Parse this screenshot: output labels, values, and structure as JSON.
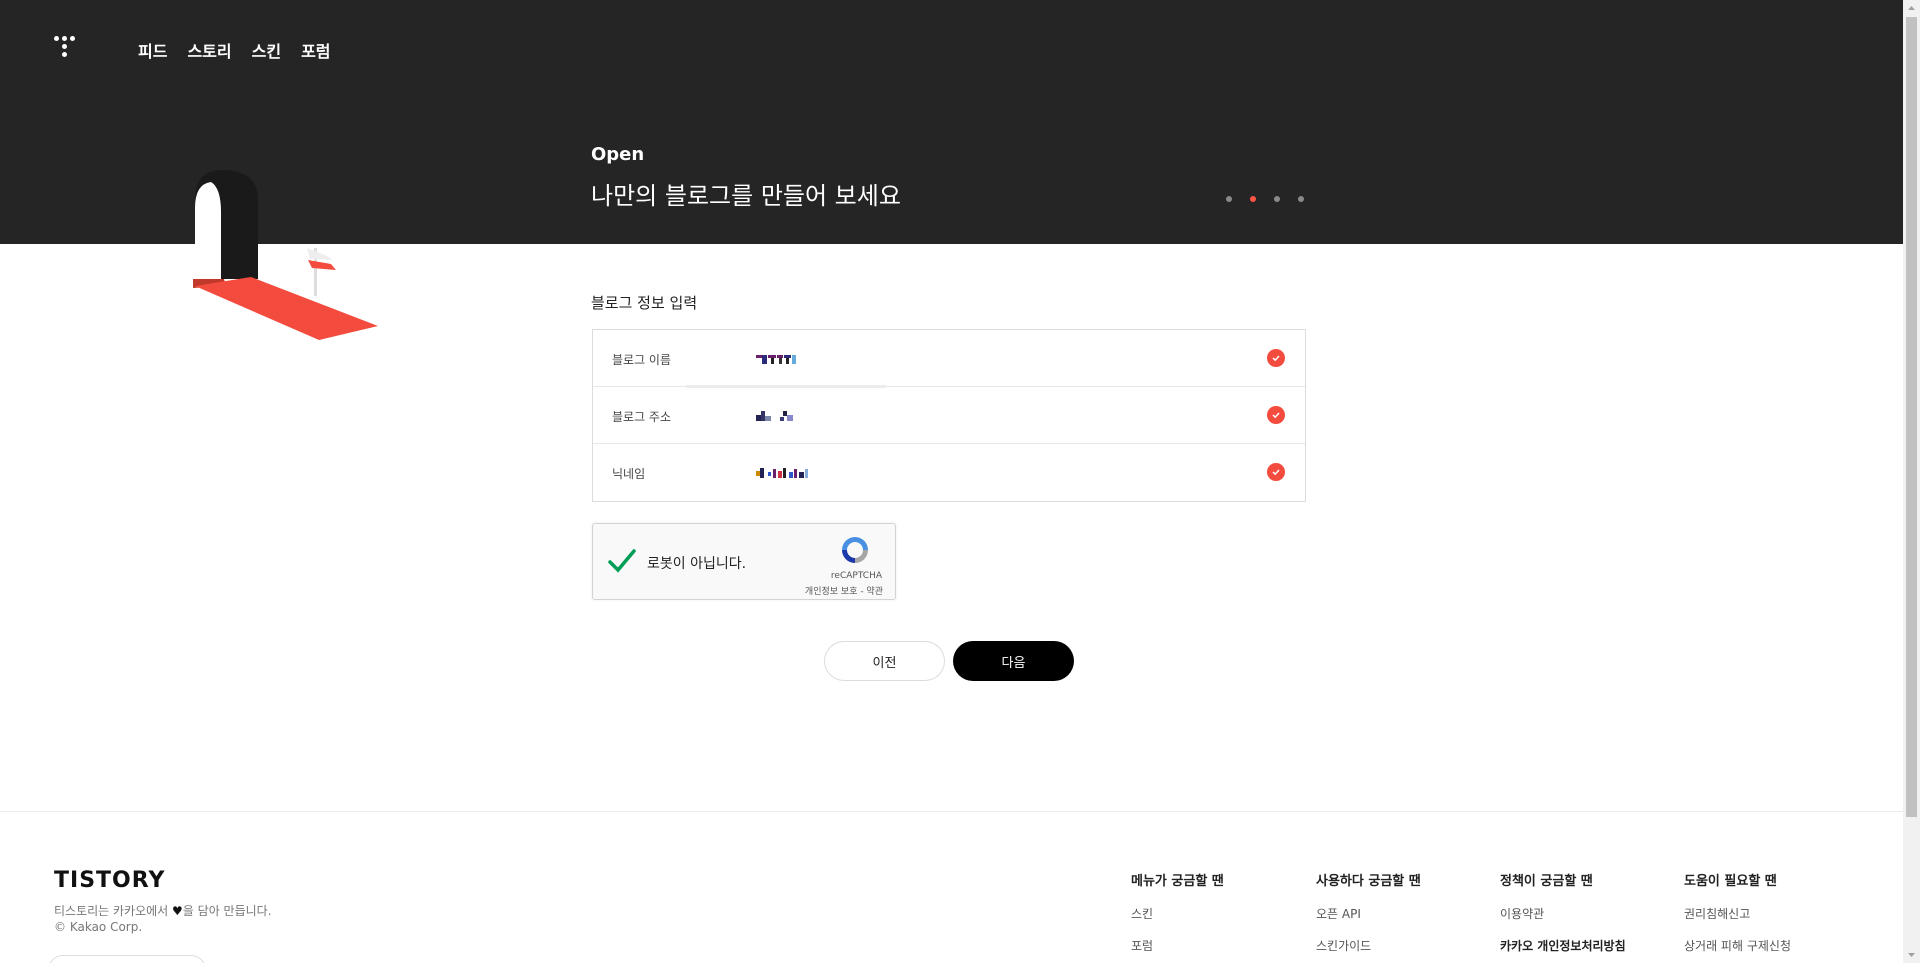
{
  "header": {
    "nav": [
      "피드",
      "스토리",
      "스킨",
      "포럼"
    ],
    "kicker": "Open",
    "title": "나만의 블로그를 만들어 보세요",
    "carousel_total": 4,
    "carousel_active": 2
  },
  "form": {
    "section_title": "블로그 정보 입력",
    "rows": [
      {
        "label": "블로그 이름",
        "value": "(redacted)",
        "valid": true
      },
      {
        "label": "블로그 주소",
        "value": "(redacted)",
        "valid": true
      },
      {
        "label": "닉네임",
        "value": "(redacted)",
        "valid": true
      }
    ]
  },
  "captcha": {
    "label": "로봇이 아닙니다.",
    "brand": "reCAPTCHA",
    "links": "개인정보 보호 - 약관",
    "checked": true
  },
  "buttons": {
    "prev": "이전",
    "next": "다음"
  },
  "footer": {
    "brand": "TISTORY",
    "desc_before": "티스토리는 카카오에서 ",
    "desc_after": "을 담아 만듭니다.",
    "copyright": "© Kakao Corp.",
    "columns": [
      {
        "title": "메뉴가 궁금할 땐",
        "links": [
          "스킨",
          "포럼"
        ]
      },
      {
        "title": "사용하다 궁금할 땐",
        "links": [
          "오픈 API",
          "스킨가이드"
        ]
      },
      {
        "title": "정책이 궁금할 땐",
        "links": [
          "이용약관",
          "카카오 개인정보처리방침"
        ]
      },
      {
        "title": "도움이 필요할 땐",
        "links": [
          "권리침해신고",
          "상거래 피해 구제신청"
        ]
      }
    ]
  },
  "colors": {
    "hero_bg": "#252525",
    "accent": "#f44b3f",
    "button_dark": "#000000"
  }
}
